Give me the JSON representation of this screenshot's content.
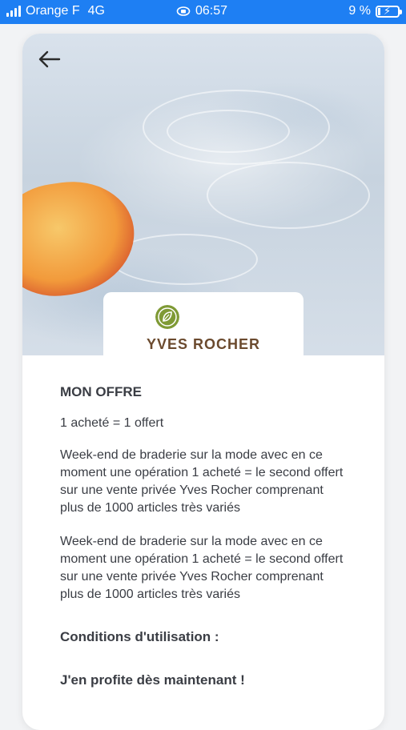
{
  "status_bar": {
    "carrier": "Orange F",
    "network": "4G",
    "time": "06:57",
    "battery": "9 %"
  },
  "colors": {
    "status_bar": "#1e7ff3",
    "brand_green": "#7f9a35",
    "brand_brown": "#6b4a2e"
  },
  "icons": {
    "back": "arrow-left-icon",
    "lock_rotation": "orientation-lock-icon",
    "brand": "yves-rocher-leaf-logo"
  },
  "brand": {
    "name": "YVES ROCHER"
  },
  "offer": {
    "heading": "MON OFFRE",
    "deal": "1 acheté = 1 offert",
    "paragraph1": "Week-end de braderie sur la mode avec en ce moment une opération 1 acheté = le second offert sur une vente privée Yves Rocher comprenant plus de 1000 articles très variés",
    "paragraph2": "Week-end de braderie sur la mode avec en ce moment une opération 1 acheté = le second offert sur une vente privée Yves Rocher comprenant plus de 1000 articles très variés",
    "conditions_heading": "Conditions d'utilisation :",
    "cta_heading": "J'en profite dès maintenant !"
  }
}
